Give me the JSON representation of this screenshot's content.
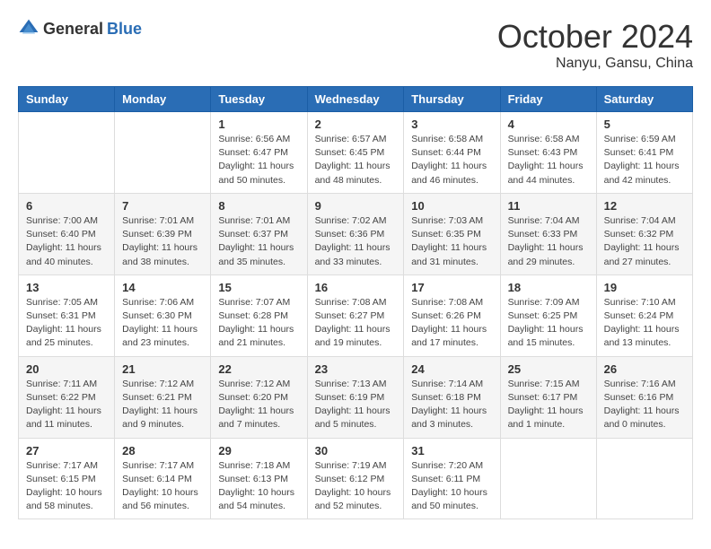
{
  "header": {
    "logo": {
      "general": "General",
      "blue": "Blue"
    },
    "title": "October 2024",
    "location": "Nanyu, Gansu, China"
  },
  "calendar": {
    "days_of_week": [
      "Sunday",
      "Monday",
      "Tuesday",
      "Wednesday",
      "Thursday",
      "Friday",
      "Saturday"
    ],
    "weeks": [
      [
        {
          "day": null,
          "info": null
        },
        {
          "day": null,
          "info": null
        },
        {
          "day": "1",
          "info": "Sunrise: 6:56 AM\nSunset: 6:47 PM\nDaylight: 11 hours and 50 minutes."
        },
        {
          "day": "2",
          "info": "Sunrise: 6:57 AM\nSunset: 6:45 PM\nDaylight: 11 hours and 48 minutes."
        },
        {
          "day": "3",
          "info": "Sunrise: 6:58 AM\nSunset: 6:44 PM\nDaylight: 11 hours and 46 minutes."
        },
        {
          "day": "4",
          "info": "Sunrise: 6:58 AM\nSunset: 6:43 PM\nDaylight: 11 hours and 44 minutes."
        },
        {
          "day": "5",
          "info": "Sunrise: 6:59 AM\nSunset: 6:41 PM\nDaylight: 11 hours and 42 minutes."
        }
      ],
      [
        {
          "day": "6",
          "info": "Sunrise: 7:00 AM\nSunset: 6:40 PM\nDaylight: 11 hours and 40 minutes."
        },
        {
          "day": "7",
          "info": "Sunrise: 7:01 AM\nSunset: 6:39 PM\nDaylight: 11 hours and 38 minutes."
        },
        {
          "day": "8",
          "info": "Sunrise: 7:01 AM\nSunset: 6:37 PM\nDaylight: 11 hours and 35 minutes."
        },
        {
          "day": "9",
          "info": "Sunrise: 7:02 AM\nSunset: 6:36 PM\nDaylight: 11 hours and 33 minutes."
        },
        {
          "day": "10",
          "info": "Sunrise: 7:03 AM\nSunset: 6:35 PM\nDaylight: 11 hours and 31 minutes."
        },
        {
          "day": "11",
          "info": "Sunrise: 7:04 AM\nSunset: 6:33 PM\nDaylight: 11 hours and 29 minutes."
        },
        {
          "day": "12",
          "info": "Sunrise: 7:04 AM\nSunset: 6:32 PM\nDaylight: 11 hours and 27 minutes."
        }
      ],
      [
        {
          "day": "13",
          "info": "Sunrise: 7:05 AM\nSunset: 6:31 PM\nDaylight: 11 hours and 25 minutes."
        },
        {
          "day": "14",
          "info": "Sunrise: 7:06 AM\nSunset: 6:30 PM\nDaylight: 11 hours and 23 minutes."
        },
        {
          "day": "15",
          "info": "Sunrise: 7:07 AM\nSunset: 6:28 PM\nDaylight: 11 hours and 21 minutes."
        },
        {
          "day": "16",
          "info": "Sunrise: 7:08 AM\nSunset: 6:27 PM\nDaylight: 11 hours and 19 minutes."
        },
        {
          "day": "17",
          "info": "Sunrise: 7:08 AM\nSunset: 6:26 PM\nDaylight: 11 hours and 17 minutes."
        },
        {
          "day": "18",
          "info": "Sunrise: 7:09 AM\nSunset: 6:25 PM\nDaylight: 11 hours and 15 minutes."
        },
        {
          "day": "19",
          "info": "Sunrise: 7:10 AM\nSunset: 6:24 PM\nDaylight: 11 hours and 13 minutes."
        }
      ],
      [
        {
          "day": "20",
          "info": "Sunrise: 7:11 AM\nSunset: 6:22 PM\nDaylight: 11 hours and 11 minutes."
        },
        {
          "day": "21",
          "info": "Sunrise: 7:12 AM\nSunset: 6:21 PM\nDaylight: 11 hours and 9 minutes."
        },
        {
          "day": "22",
          "info": "Sunrise: 7:12 AM\nSunset: 6:20 PM\nDaylight: 11 hours and 7 minutes."
        },
        {
          "day": "23",
          "info": "Sunrise: 7:13 AM\nSunset: 6:19 PM\nDaylight: 11 hours and 5 minutes."
        },
        {
          "day": "24",
          "info": "Sunrise: 7:14 AM\nSunset: 6:18 PM\nDaylight: 11 hours and 3 minutes."
        },
        {
          "day": "25",
          "info": "Sunrise: 7:15 AM\nSunset: 6:17 PM\nDaylight: 11 hours and 1 minute."
        },
        {
          "day": "26",
          "info": "Sunrise: 7:16 AM\nSunset: 6:16 PM\nDaylight: 11 hours and 0 minutes."
        }
      ],
      [
        {
          "day": "27",
          "info": "Sunrise: 7:17 AM\nSunset: 6:15 PM\nDaylight: 10 hours and 58 minutes."
        },
        {
          "day": "28",
          "info": "Sunrise: 7:17 AM\nSunset: 6:14 PM\nDaylight: 10 hours and 56 minutes."
        },
        {
          "day": "29",
          "info": "Sunrise: 7:18 AM\nSunset: 6:13 PM\nDaylight: 10 hours and 54 minutes."
        },
        {
          "day": "30",
          "info": "Sunrise: 7:19 AM\nSunset: 6:12 PM\nDaylight: 10 hours and 52 minutes."
        },
        {
          "day": "31",
          "info": "Sunrise: 7:20 AM\nSunset: 6:11 PM\nDaylight: 10 hours and 50 minutes."
        },
        {
          "day": null,
          "info": null
        },
        {
          "day": null,
          "info": null
        }
      ]
    ]
  }
}
